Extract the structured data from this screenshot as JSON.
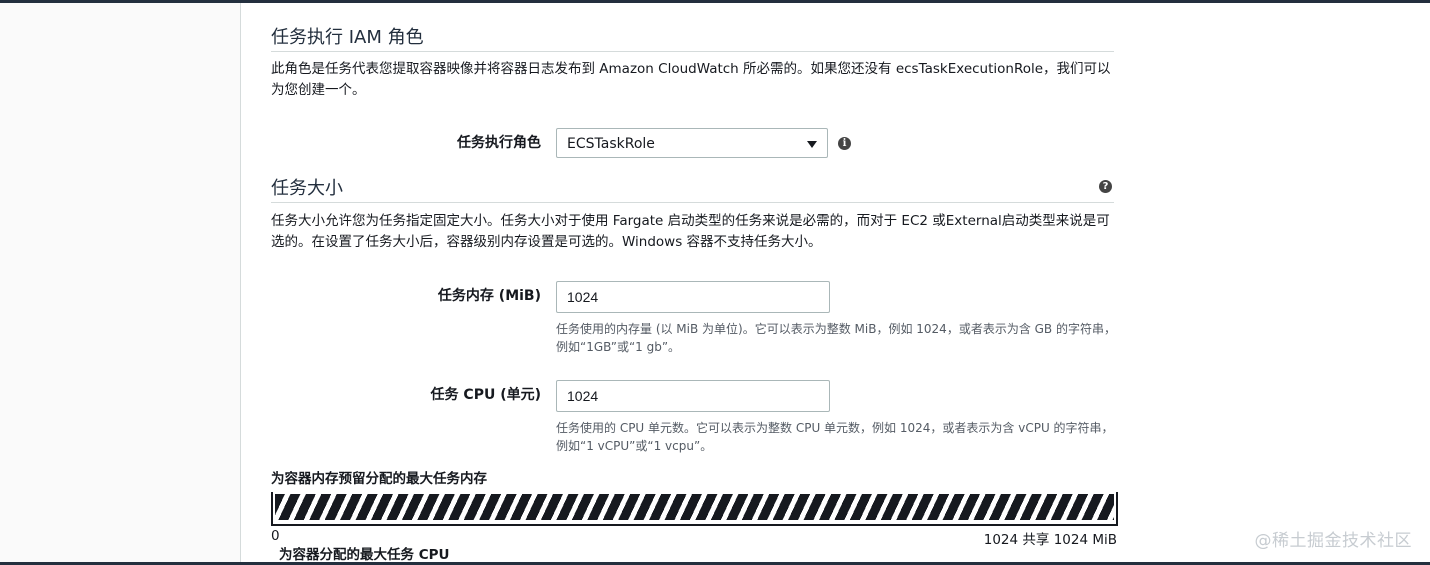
{
  "iam_section": {
    "title": "任务执行 IAM 角色",
    "description": "此角色是任务代表您提取容器映像并将容器日志发布到 Amazon CloudWatch 所必需的。如果您还没有 ecsTaskExecutionRole，我们可以为您创建一个。",
    "role_label": "任务执行角色",
    "role_value": "ECSTaskRole",
    "info_icon": "info-icon"
  },
  "size_section": {
    "title": "任务大小",
    "help_icon": "help-icon",
    "description": "任务大小允许您为任务指定固定大小。任务大小对于使用 Fargate 启动类型的任务来说是必需的，而对于 EC2 或External启动类型来说是可选的。在设置了任务大小后，容器级别内存设置是可选的。Windows 容器不支持任务大小。",
    "memory_label": "任务内存 (MiB)",
    "memory_value": "1024",
    "memory_hint": "任务使用的内存量 (以 MiB 为单位)。它可以表示为整数 MiB，例如 1024，或者表示为含 GB 的字符串，例如“1GB”或“1 gb”。",
    "cpu_label": "任务 CPU (单元)",
    "cpu_value": "1024",
    "cpu_hint": "任务使用的 CPU 单元数。它可以表示为整数 CPU 单元数，例如 1024，或者表示为含 vCPU 的字符串，例如“1 vCPU”或“1 vcpu”。"
  },
  "memory_allocation": {
    "title": "为容器内存预留分配的最大任务内存",
    "min_label": "0",
    "max_label": "1024 共享 1024 MiB",
    "fill_fraction": 1.0
  },
  "cpu_allocation": {
    "title": "为容器分配的最大任务 CPU"
  },
  "watermark": "@稀土掘金技术社区"
}
